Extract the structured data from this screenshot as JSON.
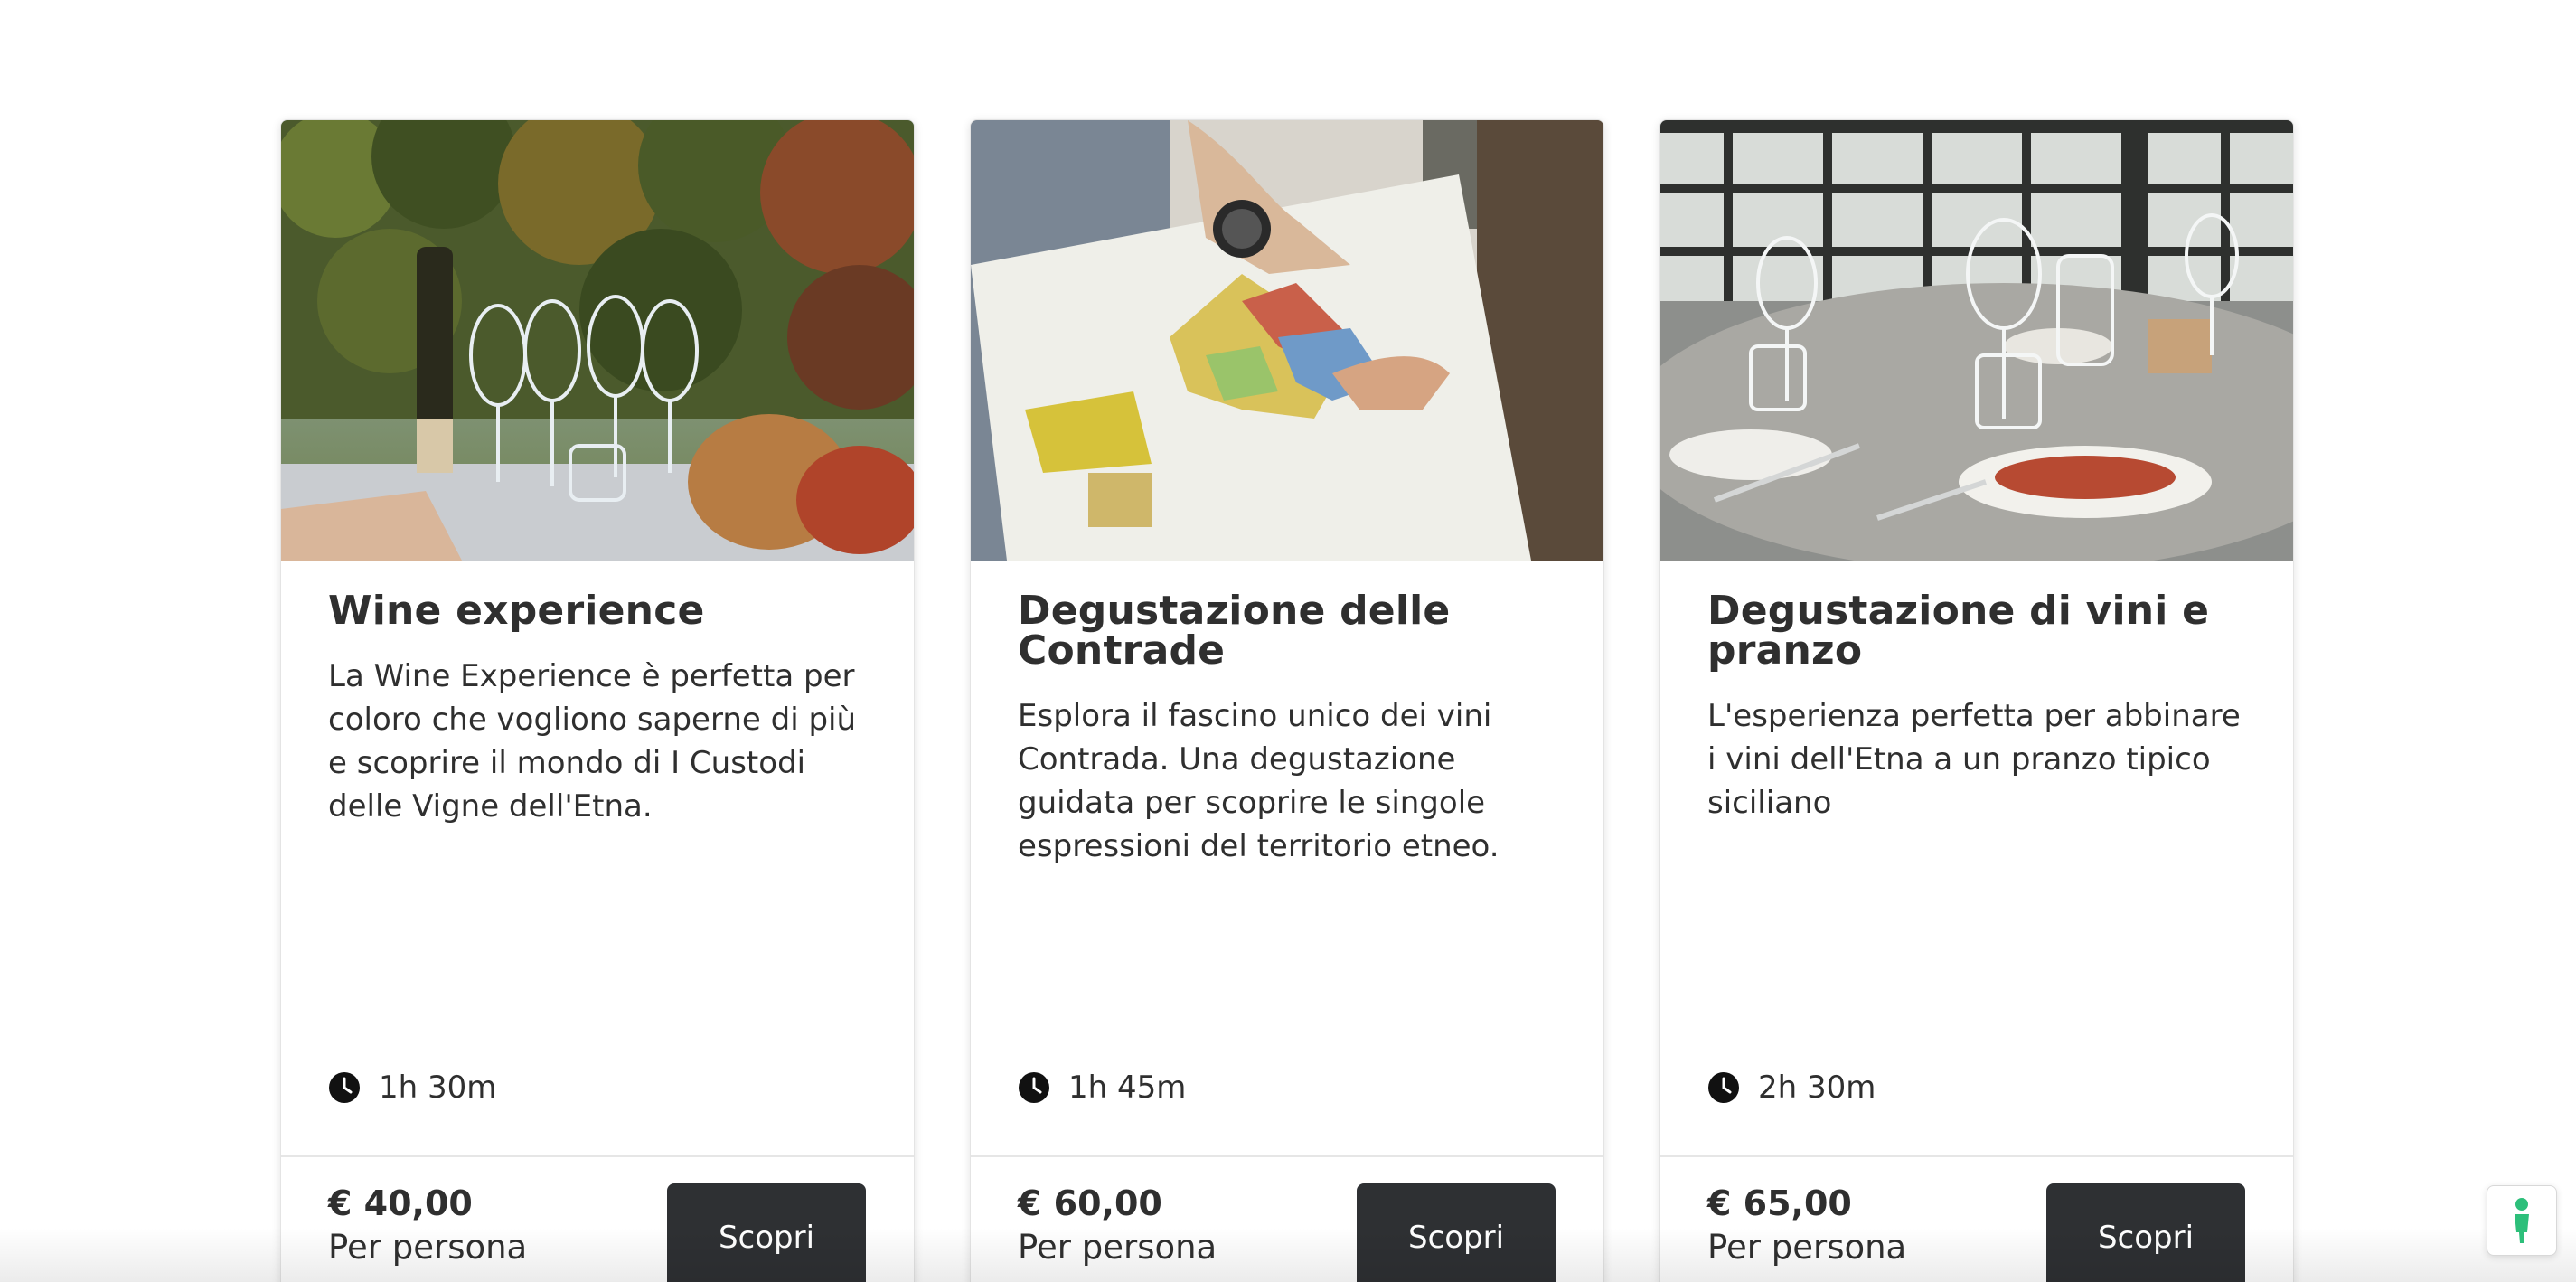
{
  "cards": [
    {
      "title": "Wine experience",
      "description": "La Wine Experience è perfetta per coloro che vogliono saperne di più e scoprire il mondo di I Custodi delle Vigne dell'Etna.",
      "duration": "1h 30m",
      "price": "€ 40,00",
      "price_unit": "Per persona",
      "button_label": "Scopri",
      "image_subject": "wine bottle, glasses and pumpkins in a vineyard"
    },
    {
      "title": "Degustazione delle Contrade",
      "description": "Esplora il fascino unico dei vini Contrada. Una degustazione guidata per scoprire le singole espressioni del territorio etneo.",
      "duration": "1h 45m",
      "price": "€ 60,00",
      "price_unit": "Per persona",
      "button_label": "Scopri",
      "image_subject": "hands pointing at a map of Etna contrade"
    },
    {
      "title": "Degustazione di vini e pranzo",
      "description": "L'esperienza perfetta per abbinare i vini dell'Etna a un pranzo tipico siciliano",
      "duration": "2h 30m",
      "price": "€ 65,00",
      "price_unit": "Per persona",
      "button_label": "Scopri",
      "image_subject": "set table with wine glasses and plates"
    }
  ],
  "icons": {
    "duration": "clock-icon",
    "widget": "cookie-preferences-icon"
  },
  "colors": {
    "button_bg": "#2e3033",
    "button_text": "#ffffff",
    "text": "#2f2f2f",
    "widget_icon": "#2dbf7a"
  }
}
